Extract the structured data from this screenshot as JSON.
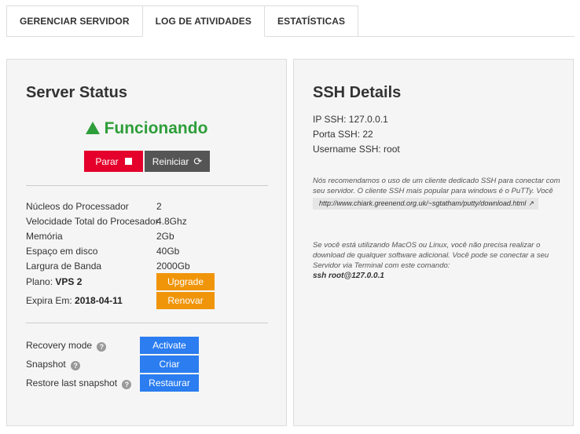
{
  "tabs": [
    {
      "label": "GERENCIAR SERVIDOR"
    },
    {
      "label": "LOG DE ATIVIDADES"
    },
    {
      "label": "ESTATÍSTICAS"
    }
  ],
  "server": {
    "title": "Server Status",
    "status": "Funcionando",
    "stop_label": "Parar",
    "restart_label": "Reiniciar",
    "specs": [
      {
        "label": "Núcleos do Processador",
        "value": "2"
      },
      {
        "label": "Velocidade Total do Procesador",
        "value": "4.8Ghz"
      },
      {
        "label": "Memória",
        "value": "2Gb"
      },
      {
        "label": "Espaço em disco",
        "value": "40Gb"
      },
      {
        "label": "Largura de Banda",
        "value": "2000Gb"
      }
    ],
    "plan_label": "Plano:",
    "plan_value": "VPS 2",
    "upgrade_label": "Upgrade",
    "expires_label": "Expira Em:",
    "expires_value": "2018-04-11",
    "renew_label": "Renovar",
    "actions": [
      {
        "label": "Recovery mode",
        "button": "Activate"
      },
      {
        "label": "Snapshot",
        "button": "Criar"
      },
      {
        "label": "Restore last snapshot",
        "button": "Restaurar"
      }
    ]
  },
  "ssh": {
    "title": "SSH Details",
    "ip": "IP SSH: 127.0.0.1",
    "port": "Porta SSH: 22",
    "username": "Username SSH: root",
    "note1": "Nós recomendamos o uso de um cliente dedicado SSH para conectar com seu servidor. O cliente SSH mais popular para windows é o PuTTy. Você pode realizar o download do PuTTy via este link:",
    "link": "http://www.chiark.greenend.org.uk/~sgtatham/putty/download.html",
    "note2": "Se você está utilizando MacOS ou Linux, você não precisa realizar o download de qualquer software adicional. Você pode se conectar a seu Servidor via Terminal com este comando:",
    "command": "ssh root@127.0.0.1"
  },
  "colors": {
    "status_green": "#2e9e3a",
    "stop_red": "#e4002b",
    "restart_gray": "#555555",
    "orange": "#f0950a",
    "blue": "#2b7df0"
  }
}
